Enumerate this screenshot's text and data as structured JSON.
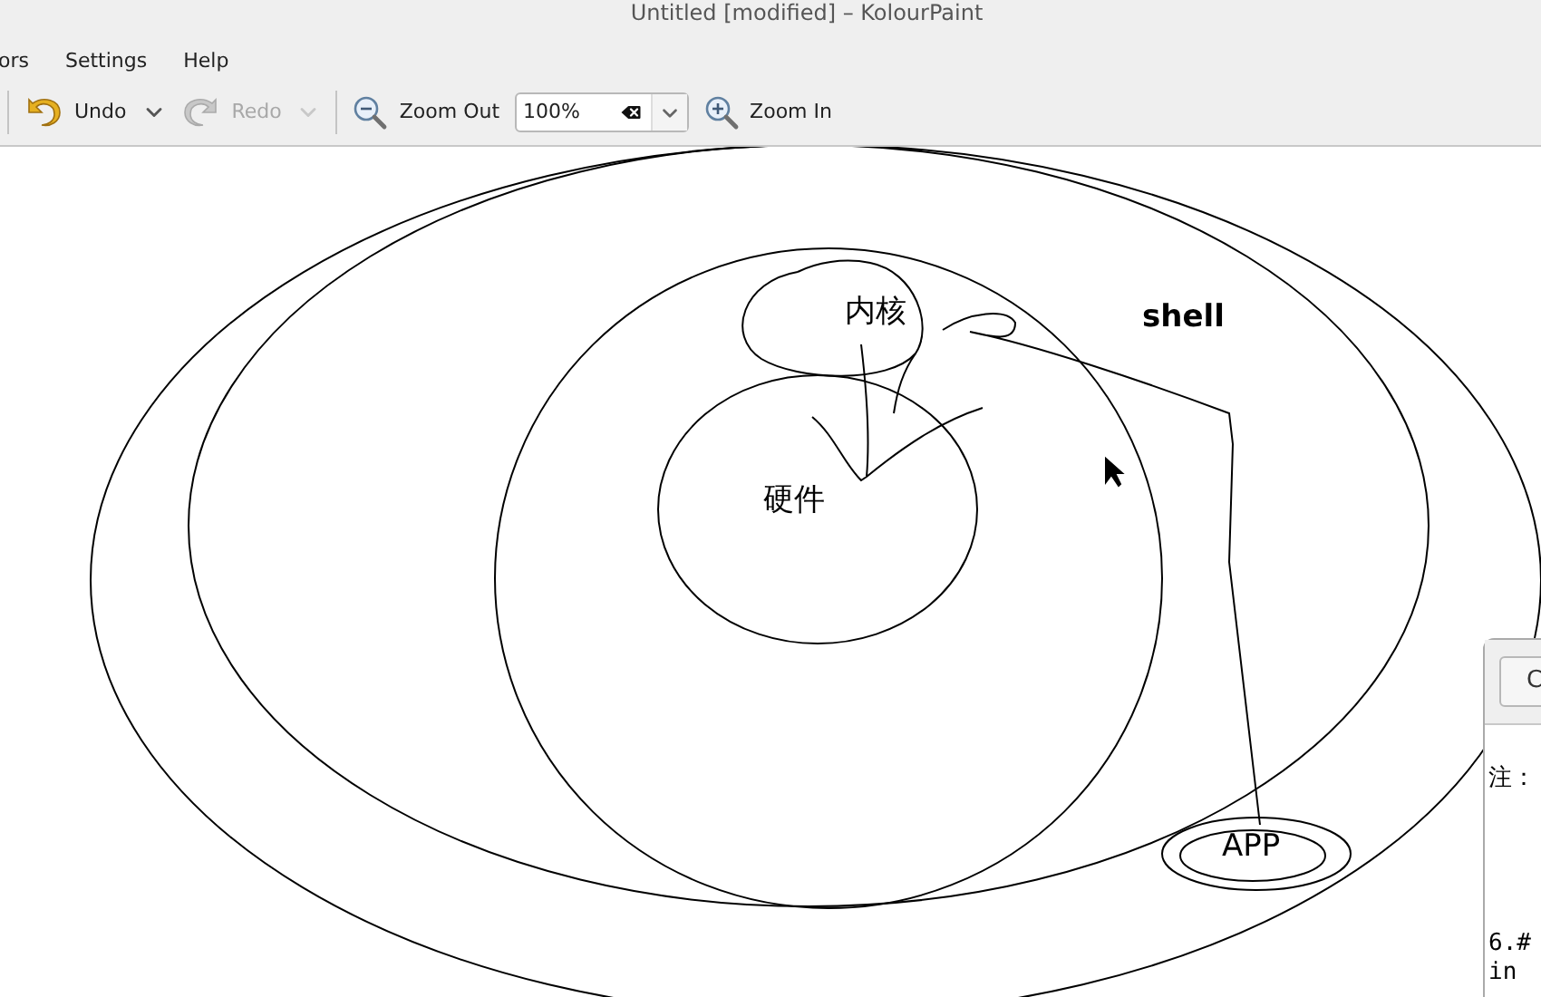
{
  "window": {
    "title": "Untitled [modified] – KolourPaint"
  },
  "menu": [
    {
      "label": "ors"
    },
    {
      "label": "Settings"
    },
    {
      "label": "Help"
    }
  ],
  "toolbar": [
    {
      "kind": "separator"
    },
    {
      "kind": "action",
      "label": "Undo",
      "disabled": false
    },
    {
      "kind": "dropdown",
      "disabled": false
    },
    {
      "kind": "action",
      "label": "Redo",
      "disabled": true
    },
    {
      "kind": "dropdown",
      "disabled": true
    },
    {
      "kind": "separator"
    },
    {
      "kind": "action",
      "label": "Zoom Out",
      "disabled": false
    },
    {
      "kind": "zoom-field",
      "value": "100%"
    },
    {
      "kind": "action",
      "label": "Zoom In",
      "disabled": false
    }
  ],
  "canvas": {
    "labels": [
      {
        "text": "内核"
      },
      {
        "text": "硬件"
      },
      {
        "text": "shell"
      },
      {
        "text": "APP"
      }
    ]
  },
  "dialog": {
    "button": "C",
    "lines": [
      "注：",
      "6.#",
      "in"
    ]
  }
}
